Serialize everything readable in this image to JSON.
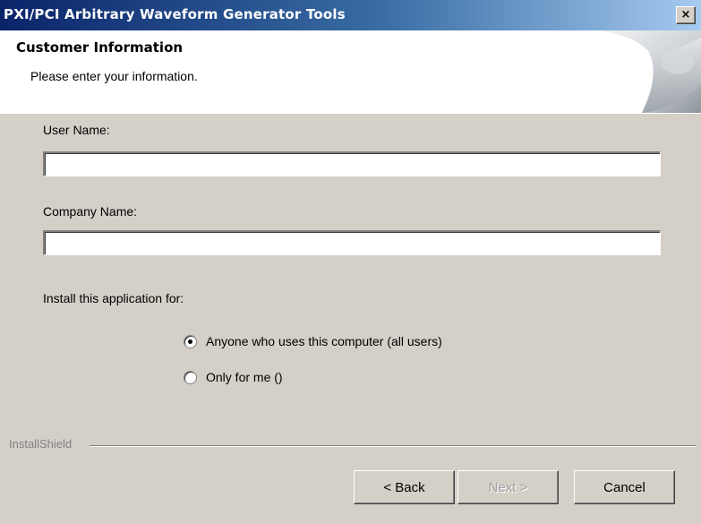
{
  "window": {
    "title": "PXI/PCI Arbitrary Waveform Generator Tools",
    "close_glyph": "×"
  },
  "header": {
    "title": "Customer Information",
    "subtitle": "Please enter your information.",
    "art_icon": "installer-page-curl-graphic"
  },
  "form": {
    "user_name_label": "User Name:",
    "user_name_value": "",
    "company_name_label": "Company Name:",
    "company_name_value": "",
    "install_for_label": "Install this application for:",
    "options": [
      {
        "label": "Anyone who uses this computer (all users)",
        "selected": true
      },
      {
        "label": "Only for me ()",
        "selected": false
      }
    ]
  },
  "footer": {
    "brand": "InstallShield",
    "back_label": "< Back",
    "next_label": "Next >",
    "next_enabled": false,
    "cancel_label": "Cancel"
  }
}
